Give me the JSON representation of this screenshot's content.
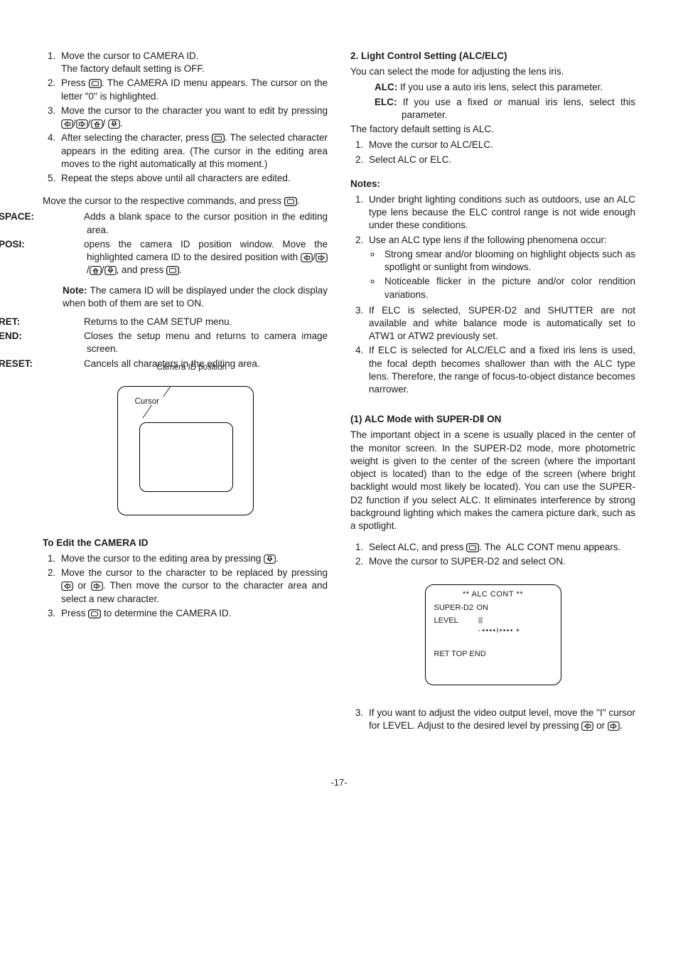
{
  "left": {
    "ol1": [
      "Move the cursor to CAMERA ID.\nThe factory default setting is OFF.",
      "Press [SET]. The CAMERA ID menu appears. The cursor on the letter \"0\" is highlighted.",
      "Move the cursor to the character you want to edit by pressing [L]/[R]/[U]/ [D].",
      "After selecting the character, press [SET]. The selected character appears in the editing area. (The cursor in the editing area moves to the right automatically at this moment.)",
      "Repeat the steps above until all characters are edited."
    ],
    "cmd_intro": "Move the cursor to the respective commands, and press [SET].",
    "space_lbl": "SPACE:",
    "space_txt": "Adds a blank space to the cursor position in the editing area.",
    "posi_lbl": "POSI:",
    "posi_txt": "opens the camera ID position window. Move the highlighted camera ID to the desired position with [L]/[R]/[U]/[D], and press [SET].",
    "posi_note": "The camera ID will be displayed under the clock display when both of them are set to ON.",
    "ret_lbl": "RET:",
    "ret_txt": "Returns to the CAM SETUP menu.",
    "end_lbl": "END:",
    "end_txt": "Closes the setup menu and returns to camera image screen.",
    "reset_lbl": "RESET:",
    "reset_txt": "Cancels all characters in the editing area.",
    "d1_caption": "Camera ID position",
    "d1_cursor": "Cursor",
    "edit_intro": "To Edit the CAMERA ID",
    "ol2": [
      "Move the cursor to the editing area by pressing [D].",
      "Move the cursor to the character to be replaced by pressing [L] or [R]. Then move the cursor to the character area and select a new character.",
      "Press [SET] to determine the CAMERA ID."
    ]
  },
  "right": {
    "alc_head": "2. Light Control Setting (ALC/ELC)",
    "alc_intro": "You can select the mode for adjusting the lens iris.",
    "alc_lbl": "ALC:",
    "alc_txt": "If you use a auto iris lens, select this parameter.",
    "elc_lbl": "ELC:",
    "elc_txt": "If you use a fixed or manual iris lens, select this parameter.",
    "alc_default": "The factory default setting is ALC.",
    "alc_steps": [
      "Move the cursor to ALC/ELC.",
      "Select ALC or ELC."
    ],
    "notes_head": "Notes:",
    "notes": [
      "Under bright lighting conditions such as outdoors, use an ALC type lens because the ELC control range is not wide enough under these conditions.",
      "Use an ALC type lens if the following phenomena occur:"
    ],
    "notes_bullets": [
      "Strong smear and/or blooming on highlight objects such as spotlight or sunlight from windows.",
      "Noticeable flicker in the picture and/or color rendition variations."
    ],
    "notes_tail": [
      "If ELC is selected, SUPER-D2 and SHUTTER are not available and white balance mode is automatically set to ATW1 or ATW2 previously set.",
      "If ELC is selected for ALC/ELC and a fixed iris lens is used, the focal depth becomes shallower than with the ALC type lens. Therefore, the range of focus-to-object distance becomes narrower."
    ],
    "sd2_head": "(1) ALC Mode with SUPER-DⅡ ON",
    "sd2_para": "The important object in a scene is usually placed in the center of the monitor screen. In the SUPER-D2 mode, more photometric weight is given to the center of the screen (where the important object is located) than to the edge of the screen (where bright backlight would most likely be located). You can use the SUPER-D2 function if you select ALC. It eliminates interference by strong background lighting which makes the camera picture dark, such as a spotlight.",
    "sd2_steps_a": [
      "Select ALC, and press [SET]. The  ALC CONT menu appears.",
      "Move the cursor to SUPER-D2 and select ON."
    ],
    "d2_title": "** ALC CONT **",
    "d2_superd2": "SUPER-D2",
    "d2_on": "ON",
    "d2_level": "LEVEL",
    "d2_scale_neg": "- ",
    "d2_scale_dots": "••••I••••",
    "d2_scale_pos": " +",
    "d2_ret": "RET   TOP   END",
    "sd2_steps_b": [
      "If you want to adjust the video output level, move the \"I\" cursor for LEVEL. Adjust to the desired level by pressing [L] or [R]."
    ]
  },
  "page": "-17-"
}
